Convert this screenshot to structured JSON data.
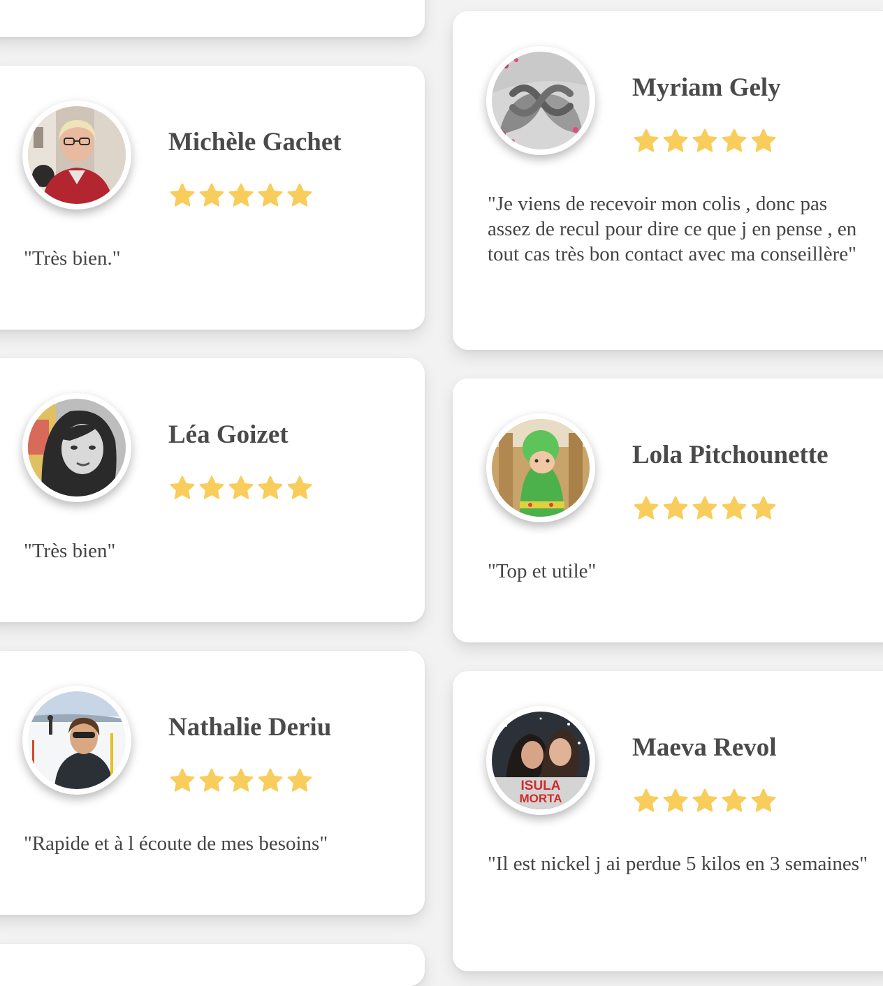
{
  "star_color": "#f8cd5b",
  "reviews": [
    {
      "name": "Michèle Gachet",
      "rating": 5,
      "quote": "\"Très bien.\"",
      "avatar": "woman-glasses-photo"
    },
    {
      "name": "Myriam Gely",
      "rating": 5,
      "quote": "\"Je viens de recevoir mon colis , donc pas assez de recul pour dire ce que j en pense , en tout cas très bon contact avec ma conseillère\"",
      "avatar": "infinity-hands-photo"
    },
    {
      "name": "Léa Goizet",
      "rating": 5,
      "quote": "\"Très bien\"",
      "avatar": "woman-portrait-photo"
    },
    {
      "name": "Lola Pitchounette",
      "rating": 5,
      "quote": "\"Top et utile\"",
      "avatar": "child-costume-photo"
    },
    {
      "name": "Nathalie Deriu",
      "rating": 5,
      "quote": "\"Rapide et à l écoute de mes besoins\"",
      "avatar": "ski-slope-photo"
    },
    {
      "name": "Maeva Revol",
      "rating": 5,
      "quote": "\"Il est nickel j ai perdue 5 kilos en 3 semaines\"",
      "avatar": "couple-photo",
      "avatar_text": [
        "ISULA",
        "MORTA"
      ]
    }
  ]
}
